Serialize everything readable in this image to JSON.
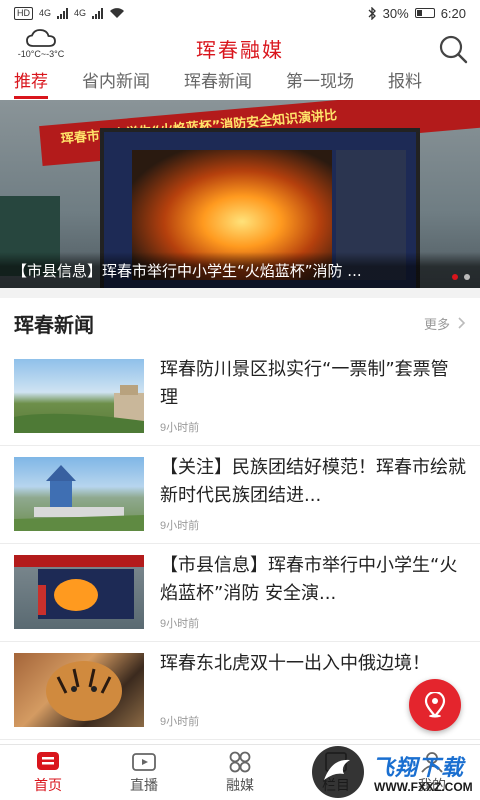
{
  "status_bar": {
    "left_label": "HD",
    "network": "4G",
    "network2": "4G",
    "battery": "30%",
    "time": "6:20"
  },
  "header": {
    "title": "珲春融媒",
    "temperature": "-10°C~-3°C"
  },
  "tabs": [
    {
      "label": "推荐",
      "active": true
    },
    {
      "label": "省内新闻",
      "active": false
    },
    {
      "label": "珲春新闻",
      "active": false
    },
    {
      "label": "第一现场",
      "active": false
    },
    {
      "label": "报料",
      "active": false
    }
  ],
  "banner": {
    "caption": "【市县信息】珲春市举行中小学生“火焰蓝杯”消防 ...",
    "slogan": "珲春市中小学生“火焰蓝杯”消防安全知识演讲比"
  },
  "section": {
    "title": "珲春新闻",
    "more_label": "更多"
  },
  "news": [
    {
      "title": "珲春防川景区拟实行“一票制”套票管理",
      "time": "9小时前"
    },
    {
      "title": "【关注】民族团结好模范！珲春市绘就新时代民族团结进...",
      "time": "9小时前"
    },
    {
      "title": "【市县信息】珲春市举行中小学生“火焰蓝杯”消防 安全演...",
      "time": "9小时前"
    },
    {
      "title": "珲春东北虎双十一出入中俄边境！",
      "time": "9小时前"
    }
  ],
  "bottom_nav": [
    {
      "label": "首页",
      "active": true
    },
    {
      "label": "直播",
      "active": false
    },
    {
      "label": "融媒",
      "active": false
    },
    {
      "label": "栏目",
      "active": false
    },
    {
      "label": "我的",
      "active": false
    }
  ],
  "watermark": {
    "brand": "飞翔下载",
    "url": "WWW.FXXZ.COM"
  },
  "colors": {
    "accent": "#d9151c"
  }
}
